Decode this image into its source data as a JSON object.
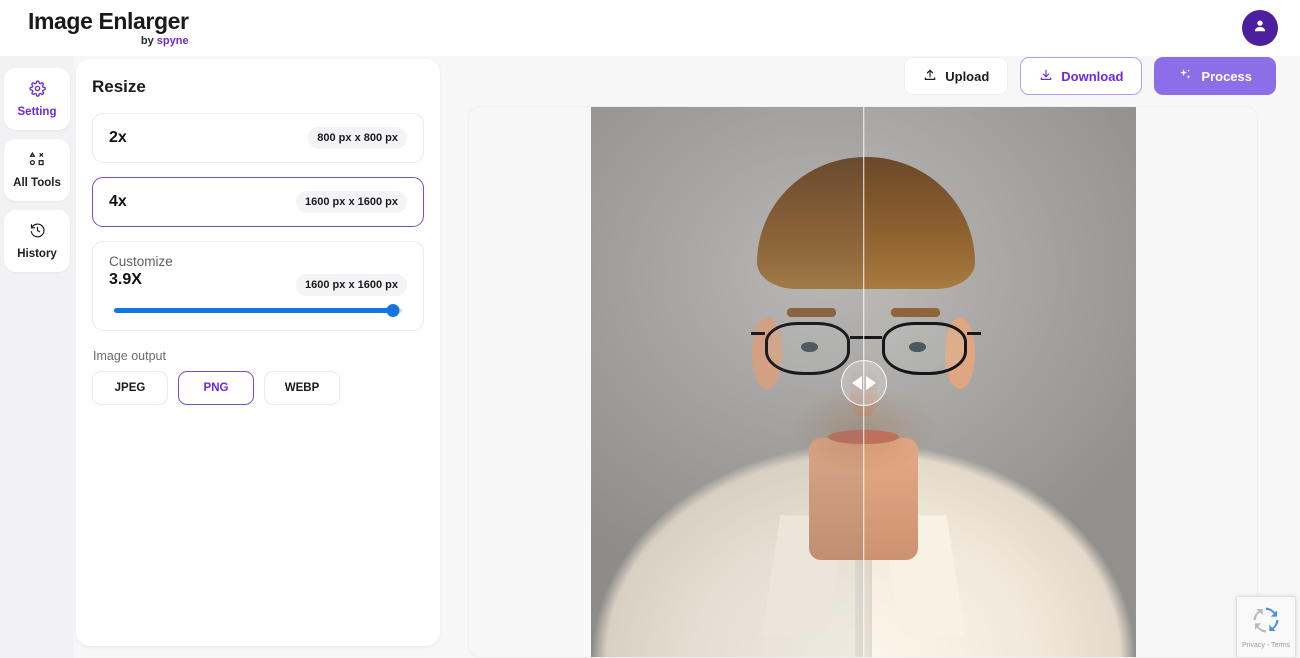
{
  "app": {
    "logo_title": "Image Enlarger",
    "logo_by": "by ",
    "logo_brand": "spyne",
    "avatar_icon": "user-avatar-icon"
  },
  "rail": {
    "items": [
      {
        "label": "Setting",
        "icon": "gear-icon",
        "active": true
      },
      {
        "label": "All Tools",
        "icon": "shapes-grid-icon",
        "active": false
      },
      {
        "label": "History",
        "icon": "history-clock-icon",
        "active": false
      }
    ]
  },
  "panel": {
    "title": "Resize",
    "scales": [
      {
        "label": "2x",
        "dimensions": "800 px x 800 px",
        "selected": false
      },
      {
        "label": "4x",
        "dimensions": "1600 px x 1600 px",
        "selected": true
      }
    ],
    "customize": {
      "title": "Customize",
      "value": "3.9X",
      "dimensions": "1600 px x 1600 px",
      "slider_percent": 97,
      "slider_color": "#1575e0"
    },
    "output": {
      "label": "Image output",
      "formats": [
        {
          "label": "JPEG",
          "selected": false
        },
        {
          "label": "PNG",
          "selected": true
        },
        {
          "label": "WEBP",
          "selected": false
        }
      ]
    }
  },
  "toolbar": {
    "upload_label": "Upload",
    "upload_icon": "upload-icon",
    "download_label": "Download",
    "download_icon": "download-icon",
    "process_label": "Process",
    "process_icon": "sparkle-icon",
    "process_color": "#8b6ee8"
  },
  "canvas": {
    "compare_handle_icon": "compare-slider-handle-icon",
    "split_percent": 50
  },
  "recaptcha": {
    "icon": "recaptcha-icon",
    "legal": "Privacy - Terms"
  }
}
